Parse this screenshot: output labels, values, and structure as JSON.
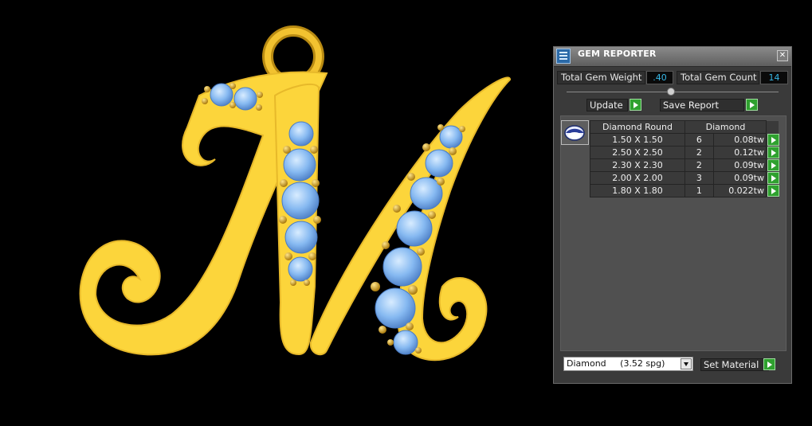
{
  "panel": {
    "title": "GEM REPORTER",
    "close_glyph": "✕",
    "total_weight_label": "Total Gem Weight",
    "total_weight_value": ".40",
    "total_count_label": "Total Gem Count",
    "total_count_value": "14",
    "update_label": "Update",
    "save_report_label": "Save Report",
    "table": {
      "col_shape": "Diamond Round",
      "col_material": "Diamond",
      "rows": [
        {
          "size": "1.50 X 1.50",
          "qty": "6",
          "weight": "0.08tw"
        },
        {
          "size": "2.50 X 2.50",
          "qty": "2",
          "weight": "0.12tw"
        },
        {
          "size": "2.30 X 2.30",
          "qty": "2",
          "weight": "0.09tw"
        },
        {
          "size": "2.00 X 2.00",
          "qty": "3",
          "weight": "0.09tw"
        },
        {
          "size": "1.80 X 1.80",
          "qty": "1",
          "weight": "0.022tw"
        }
      ]
    },
    "material_select": "Diamond     (3.52 spg)",
    "set_material_label": "Set Material"
  },
  "colors": {
    "gold": "#fcd53b",
    "gem": "#7fb4f0",
    "accent_value": "#37b8e6",
    "play_green": "#2fa12f"
  },
  "icons": {
    "app": "gem-reporter-icon",
    "close": "close-icon",
    "play": "play-arrow-icon",
    "thumb": "round-gem-icon",
    "dropdown": "chevron-down-icon"
  }
}
